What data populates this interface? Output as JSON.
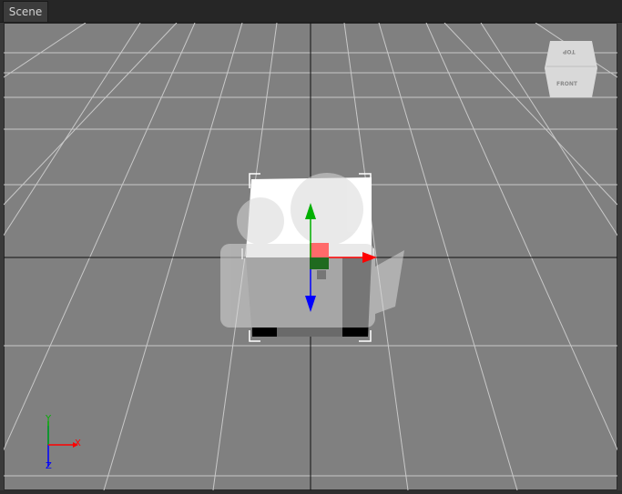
{
  "tabs": {
    "scene": "Scene"
  },
  "view_cube": {
    "top_label": "TOP",
    "front_label": "FRONT"
  },
  "axis_widget": {
    "x": "X",
    "y": "Y",
    "z": "Z"
  },
  "gizmo_colors": {
    "x": "#ff0000",
    "y": "#00b000",
    "z": "#0000ff"
  },
  "icons": [
    "camera-watermark-icon",
    "move-gizmo-icon",
    "view-cube-icon",
    "axis-orientation-icon"
  ]
}
